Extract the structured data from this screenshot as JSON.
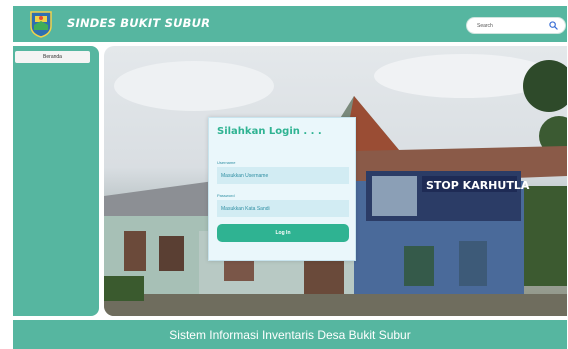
{
  "header": {
    "title": "SINDES BUKIT SUBUR",
    "logo_icon": "district-emblem-icon",
    "search": {
      "placeholder": "Search",
      "icon": "search-icon"
    }
  },
  "sidebar": {
    "items": [
      {
        "label": "Beranda"
      }
    ]
  },
  "hero": {
    "sign_text": "STOP KARHUTLA"
  },
  "login": {
    "title": "Silahkan Login . . .",
    "username_label": "Username",
    "username_placeholder": "Masukkan Username",
    "password_label": "Password",
    "password_placeholder": "Masukkan Kata Sandi",
    "button_label": "Log In"
  },
  "footer": {
    "text": "Sistem Informasi Inventaris Desa Bukit Subur"
  },
  "colors": {
    "primary": "#56b6a0",
    "accent": "#2fb392",
    "card_bg": "#eaf7fb",
    "input_bg": "#d2ecf3"
  }
}
